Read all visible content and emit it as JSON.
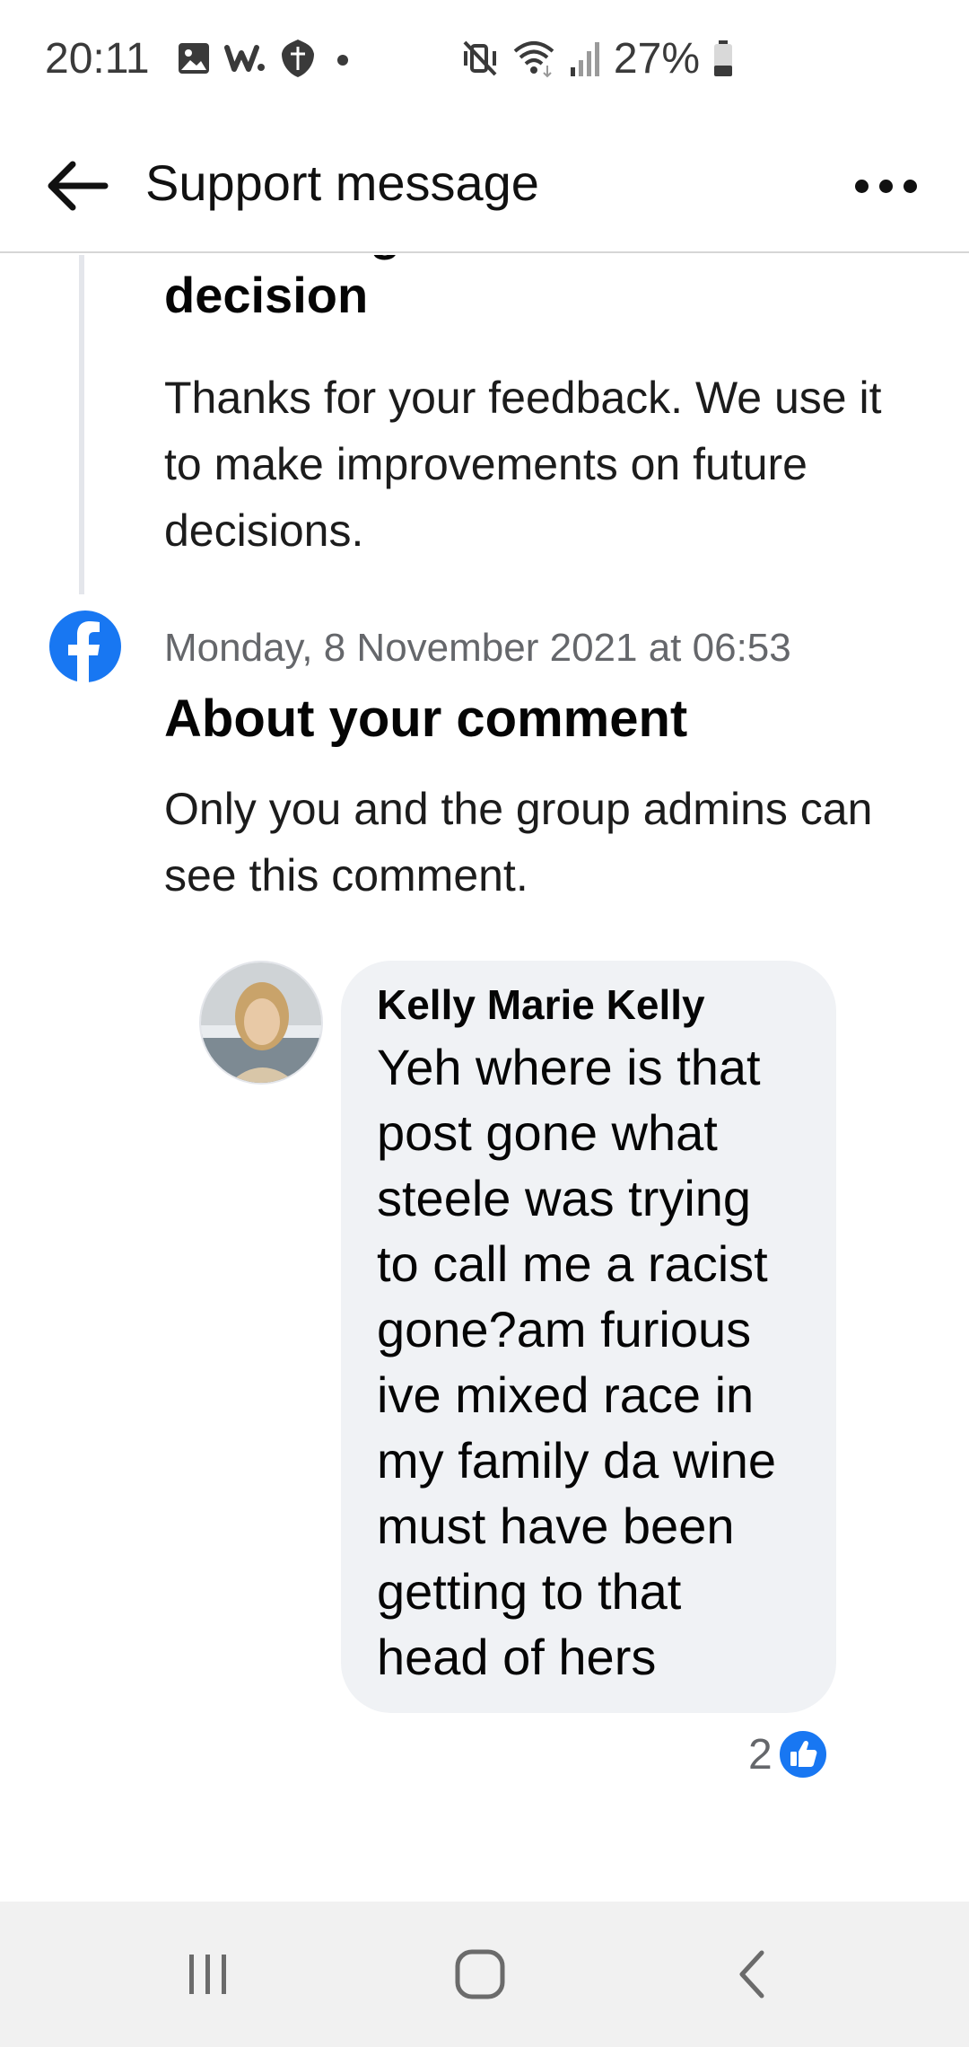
{
  "status_bar": {
    "time": "20:11",
    "battery_percent": "27%",
    "left_icons": [
      "gallery-icon",
      "w-app-icon",
      "bank-shield-icon",
      "dot-icon"
    ],
    "right_icons": [
      "mute-vibrate-icon",
      "wifi-icon",
      "signal-icon",
      "battery-icon"
    ]
  },
  "header": {
    "title": "Support message",
    "back_icon": "arrow-left-icon",
    "more_icon": "more-horizontal-icon"
  },
  "events": [
    {
      "title": "You disagreed with the decision",
      "body": "Thanks for your feedback. We use it to make improvements on future decisions."
    },
    {
      "date": "Monday, 8 November 2021 at 06:53",
      "title": "About your comment",
      "body": "Only you and the group admins can see this comment.",
      "icon": "facebook-icon"
    }
  ],
  "comment": {
    "author": "Kelly Marie Kelly",
    "text": "Yeh where is that post gone what steele was trying to call me a racist gone?am furious ive mixed race in my family da wine must have been getting to that head of hers",
    "reaction_count": "2",
    "reaction_icon": "like-icon"
  },
  "nav_bar": {
    "icons": [
      "recent-apps-icon",
      "home-icon",
      "back-icon"
    ]
  },
  "colors": {
    "facebook_blue": "#1877f2",
    "bubble_bg": "#f0f2f5",
    "timeline_line": "#e4e6eb",
    "secondary_text": "#65676b"
  }
}
